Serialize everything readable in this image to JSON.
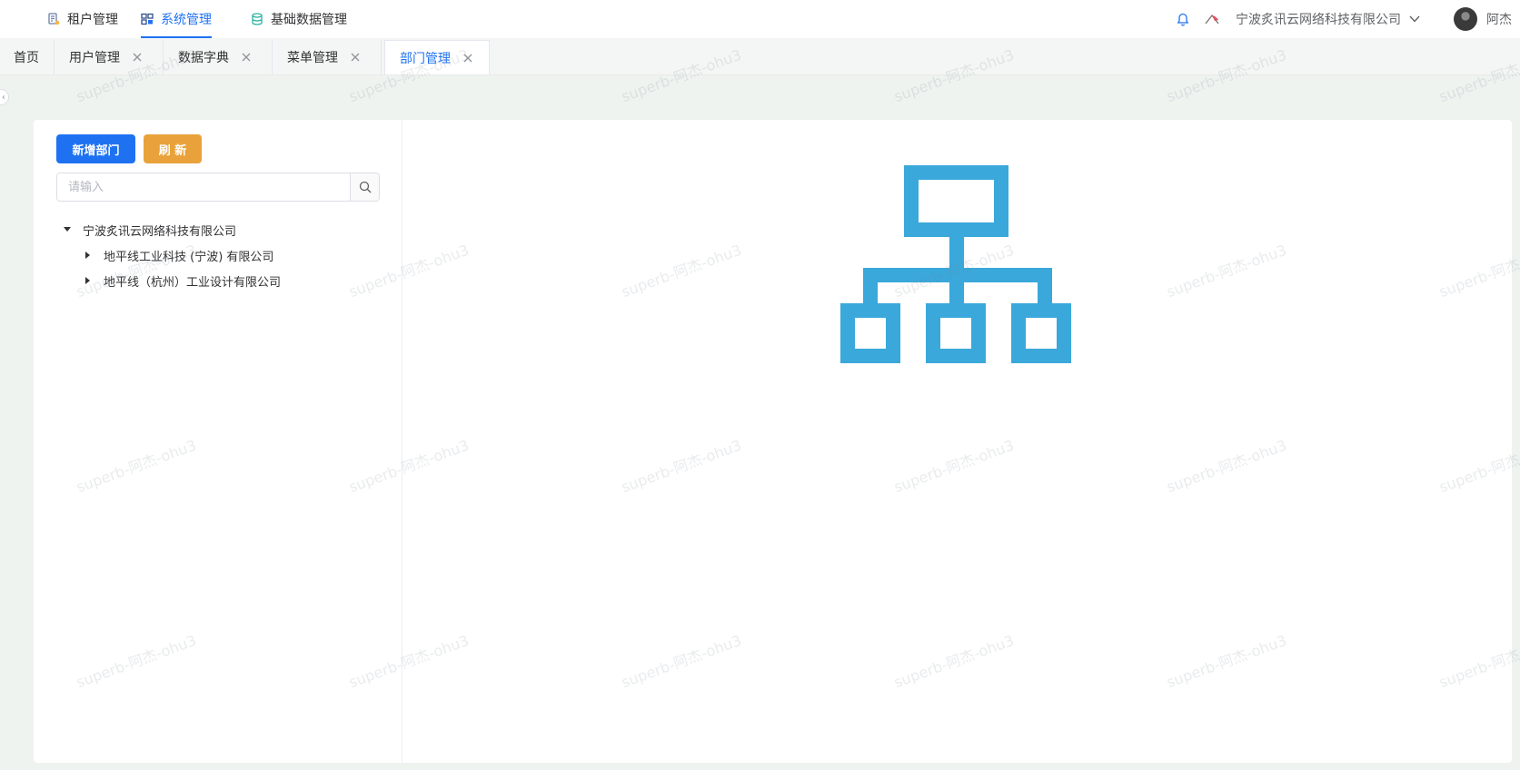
{
  "topnav": {
    "menus": [
      {
        "label": "租户管理",
        "icon": "tenant-icon",
        "active": false
      },
      {
        "label": "系统管理",
        "icon": "system-grid-icon",
        "active": true
      },
      {
        "label": "基础数据管理",
        "icon": "database-icon",
        "active": false
      }
    ],
    "company": "宁波炙讯云网络科技有限公司",
    "user_name": "阿杰"
  },
  "tabs": [
    {
      "label": "首页",
      "closable": false,
      "active": false
    },
    {
      "label": "用户管理",
      "closable": true,
      "active": false
    },
    {
      "label": "数据字典",
      "closable": true,
      "active": false
    },
    {
      "label": "菜单管理",
      "closable": true,
      "active": false
    },
    {
      "label": "部门管理",
      "closable": true,
      "active": true
    }
  ],
  "dept": {
    "add_button": "新增部门",
    "refresh_button": "刷 新",
    "search_placeholder": "请输入",
    "tree": {
      "root": "宁波炙讯云网络科技有限公司",
      "children": [
        "地平线工业科技 (宁波) 有限公司",
        "地平线（杭州）工业设计有限公司"
      ]
    }
  },
  "watermark_text": "superb-阿杰-ohu3",
  "colors": {
    "primary": "#1e72f2",
    "warning": "#e9a23b",
    "illustration": "#3aa8da"
  }
}
